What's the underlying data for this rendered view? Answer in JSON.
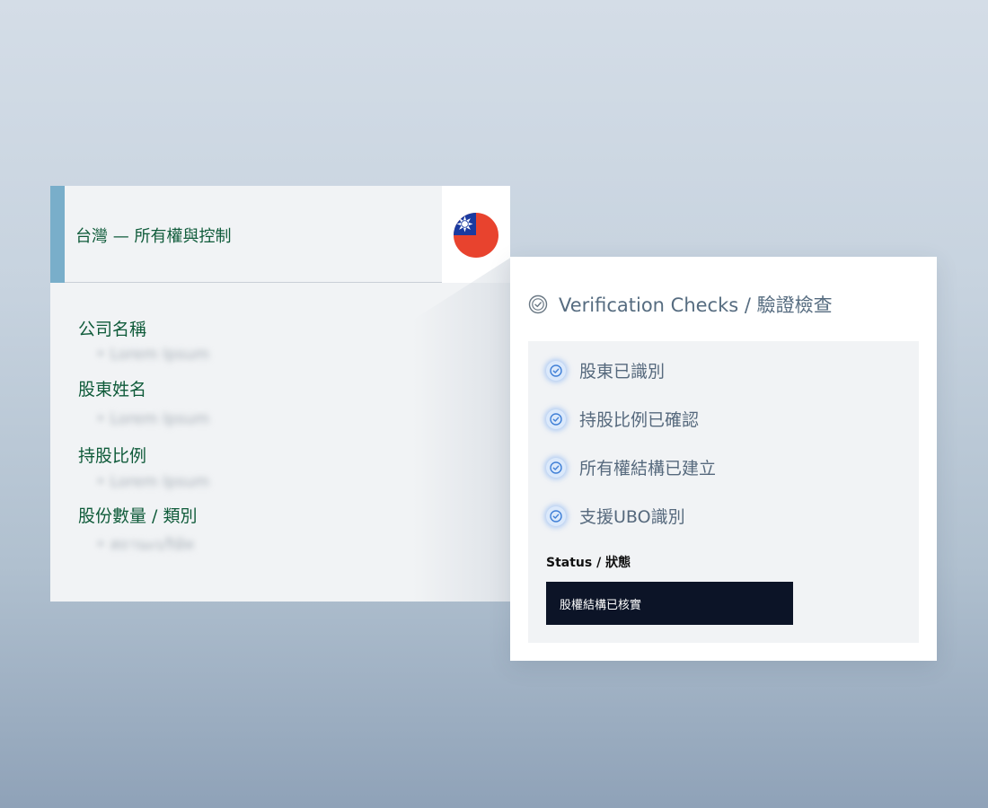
{
  "left_card": {
    "title": "台灣 — 所有權與控制",
    "flag_icon": "taiwan-flag",
    "fields": [
      {
        "label": "公司名稱",
        "value": "Lorem Ipsum"
      },
      {
        "label": "股東姓名",
        "value": "Lorem Ipsum"
      },
      {
        "label": "持股比例",
        "value": "Lorem Ipsum"
      },
      {
        "label": "股份數量 / 類別",
        "value": "สถานะบริษัท"
      }
    ]
  },
  "right_card": {
    "title": "Verification Checks / 驗證檢查",
    "checks": [
      {
        "label": "股東已識別"
      },
      {
        "label": "持股比例已確認"
      },
      {
        "label": "所有權結構已建立"
      },
      {
        "label": "支援UBO識別"
      }
    ],
    "status_label": "Status / 狀態",
    "status_value": "股權結構已核實"
  },
  "colors": {
    "accent": "#79aeca",
    "label_green": "#0f5b3a",
    "status_bg": "#0c1427",
    "check_glow": "#78aaf0"
  }
}
